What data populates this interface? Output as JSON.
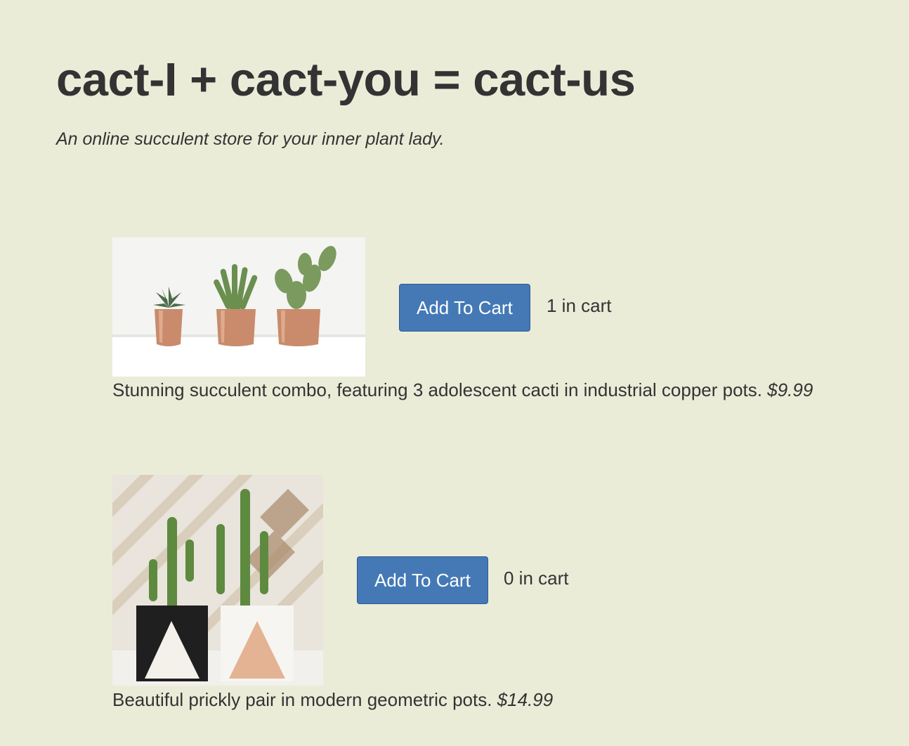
{
  "header": {
    "title": "cact-I + cact-you = cact-us",
    "subtitle": "An online succulent store for your inner plant lady."
  },
  "products": [
    {
      "image_alt": "Three small succulents in copper pots",
      "button_label": "Add To Cart",
      "cart_count": "1 in cart",
      "description": "Stunning succulent combo, featuring 3 adolescent cacti in industrial copper pots.",
      "price": "$9.99"
    },
    {
      "image_alt": "Two cacti in black and white geometric pots",
      "button_label": "Add To Cart",
      "cart_count": "0 in cart",
      "description": "Beautiful prickly pair in modern geometric pots.",
      "price": "$14.99"
    }
  ],
  "colors": {
    "background": "#ebecd8",
    "button": "#4479b6",
    "text": "#333333"
  }
}
